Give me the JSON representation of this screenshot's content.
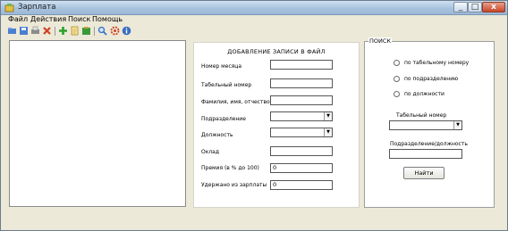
{
  "window": {
    "title": "Зарплата",
    "min": "_",
    "max": "□",
    "close": "x"
  },
  "menu": [
    "Файл",
    "Действия",
    "Поиск",
    "Помощь"
  ],
  "toolbar": {
    "buttons": [
      {
        "icon": "open-icon",
        "color": "#4a7fd0"
      },
      {
        "icon": "save-icon",
        "color": "#4a7fd0"
      },
      {
        "icon": "print-icon",
        "color": "#8c8c8c"
      },
      {
        "icon": "cut-icon",
        "color": "#d04020"
      },
      {
        "icon": "add-icon",
        "color": "#2ea02e"
      },
      {
        "icon": "copy-icon",
        "color": "#d0a020"
      },
      {
        "icon": "paste-icon",
        "color": "#3a9a3a"
      },
      {
        "icon": "find-icon",
        "color": "#3a6fc0"
      },
      {
        "icon": "settings-icon",
        "color": "#d04020"
      },
      {
        "icon": "info-icon",
        "color": "#3a6fc0"
      }
    ]
  },
  "add_record": {
    "title": "ДОБАВЛЕНИЕ ЗАПИСИ В ФАЙЛ",
    "month_label": "Номер месяца",
    "tab_label": "Табельный номер",
    "name_label": "Фамилия, имя, отчество",
    "dept_label": "Подразделение",
    "position_label": "Должность",
    "salary_label": "Оклад",
    "bonus_label": "Премия (в % до 100)",
    "bonus_value": "0",
    "deduct_label": "Удержано из зарплаты",
    "deduct_value": "0"
  },
  "search": {
    "legend": "ПОИСК",
    "radio_tab": "по табельному номеру",
    "radio_dept": "по подразделению",
    "radio_position": "по должности",
    "tab_label": "Табельный номер",
    "dept_label": "Подразделение/должность",
    "find_button": "Найти"
  },
  "colors": {
    "window_bg": "#ece9d8",
    "title_gradient_top": "#cfe0f1",
    "close_red": "#c7452a"
  }
}
